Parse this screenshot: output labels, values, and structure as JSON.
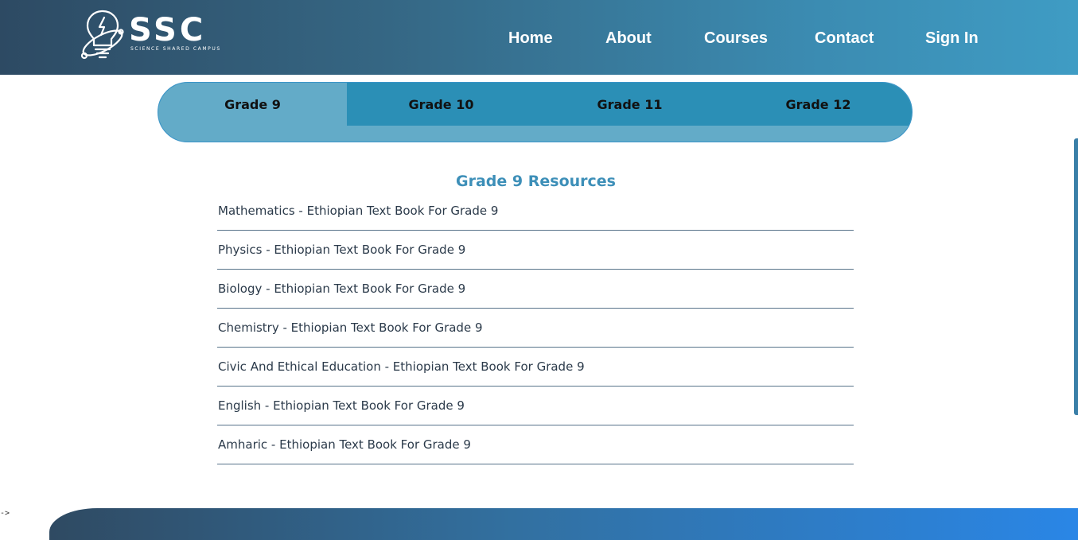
{
  "brand": {
    "name": "SSC",
    "tagline": "SCIENCE SHARED CAMPUS",
    "logo_icon": "lightbulb-atom-icon"
  },
  "nav": {
    "items": [
      {
        "label": "Home"
      },
      {
        "label": "About"
      },
      {
        "label": "Courses"
      },
      {
        "label": "Contact"
      },
      {
        "label": "Sign In"
      }
    ]
  },
  "tabs": {
    "items": [
      {
        "label": "Grade 9",
        "active": true
      },
      {
        "label": "Grade 10",
        "active": false
      },
      {
        "label": "Grade 11",
        "active": false
      },
      {
        "label": "Grade 12",
        "active": false
      }
    ]
  },
  "resources": {
    "title": "Grade 9 Resources",
    "items": [
      {
        "label": "Mathematics - Ethiopian Text Book For Grade 9"
      },
      {
        "label": "Physics - Ethiopian Text Book For Grade 9"
      },
      {
        "label": "Biology - Ethiopian Text Book For Grade 9"
      },
      {
        "label": "Chemistry - Ethiopian Text Book For Grade 9"
      },
      {
        "label": "Civic And Ethical Education - Ethiopian Text Book For Grade 9"
      },
      {
        "label": "English - Ethiopian Text Book For Grade 9"
      },
      {
        "label": "Amharic - Ethiopian Text Book For Grade 9"
      }
    ]
  },
  "footer": {
    "stray_text": "->"
  },
  "colors": {
    "header_start": "#2d4a63",
    "header_end": "#3f9cc4",
    "tab_active": "#63abc8",
    "tab_inactive": "#2b8fb6",
    "resources_title": "#3d8fb8",
    "divider": "#58738a"
  }
}
